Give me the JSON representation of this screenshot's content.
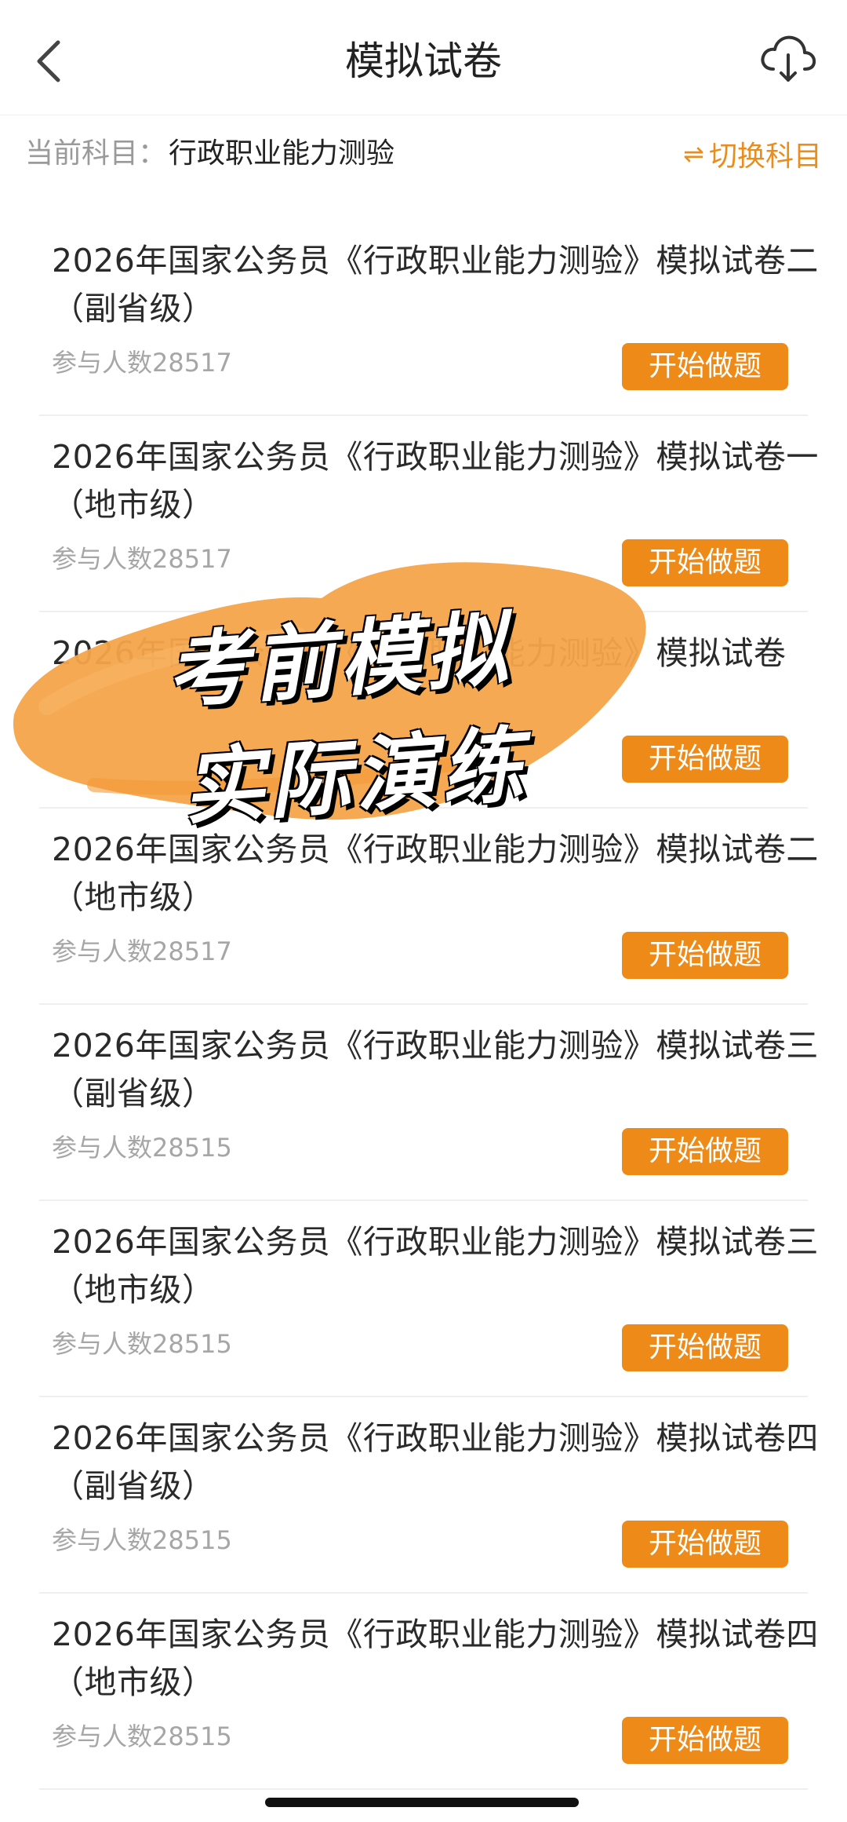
{
  "header": {
    "title": "模拟试卷",
    "back_icon": "chevron-left-icon",
    "download_icon": "cloud-download-icon"
  },
  "subject": {
    "label": "当前科目：",
    "value": "行政职业能力测验",
    "switch_label": "切换科目",
    "switch_icon": "swap-arrows-icon",
    "accent_color": "#e98d1d"
  },
  "papers": [
    {
      "title": "2026年国家公务员《行政职业能力测验》模拟试卷二（副省级）",
      "participants": "参与人数28517",
      "button": "开始做题"
    },
    {
      "title": "2026年国家公务员《行政职业能力测验》模拟试卷一（地市级）",
      "participants": "参与人数28517",
      "button": "开始做题"
    },
    {
      "title": "2026年国家公务员《行政职业能力测验》模拟试卷",
      "participants": "",
      "button": "开始做题"
    },
    {
      "title": "2026年国家公务员《行政职业能力测验》模拟试卷二（地市级）",
      "participants": "参与人数28517",
      "button": "开始做题"
    },
    {
      "title": "2026年国家公务员《行政职业能力测验》模拟试卷三（副省级）",
      "participants": "参与人数28515",
      "button": "开始做题"
    },
    {
      "title": "2026年国家公务员《行政职业能力测验》模拟试卷三（地市级）",
      "participants": "参与人数28515",
      "button": "开始做题"
    },
    {
      "title": "2026年国家公务员《行政职业能力测验》模拟试卷四（副省级）",
      "participants": "参与人数28515",
      "button": "开始做题"
    },
    {
      "title": "2026年国家公务员《行政职业能力测验》模拟试卷四（地市级）",
      "participants": "参与人数28515",
      "button": "开始做题"
    }
  ],
  "overlay": {
    "line1": "考前模拟",
    "line2": "实际演练",
    "brush_color": "#f5a44a"
  },
  "colors": {
    "button_bg": "#ee8a18",
    "muted_text": "#a6a6a6"
  }
}
